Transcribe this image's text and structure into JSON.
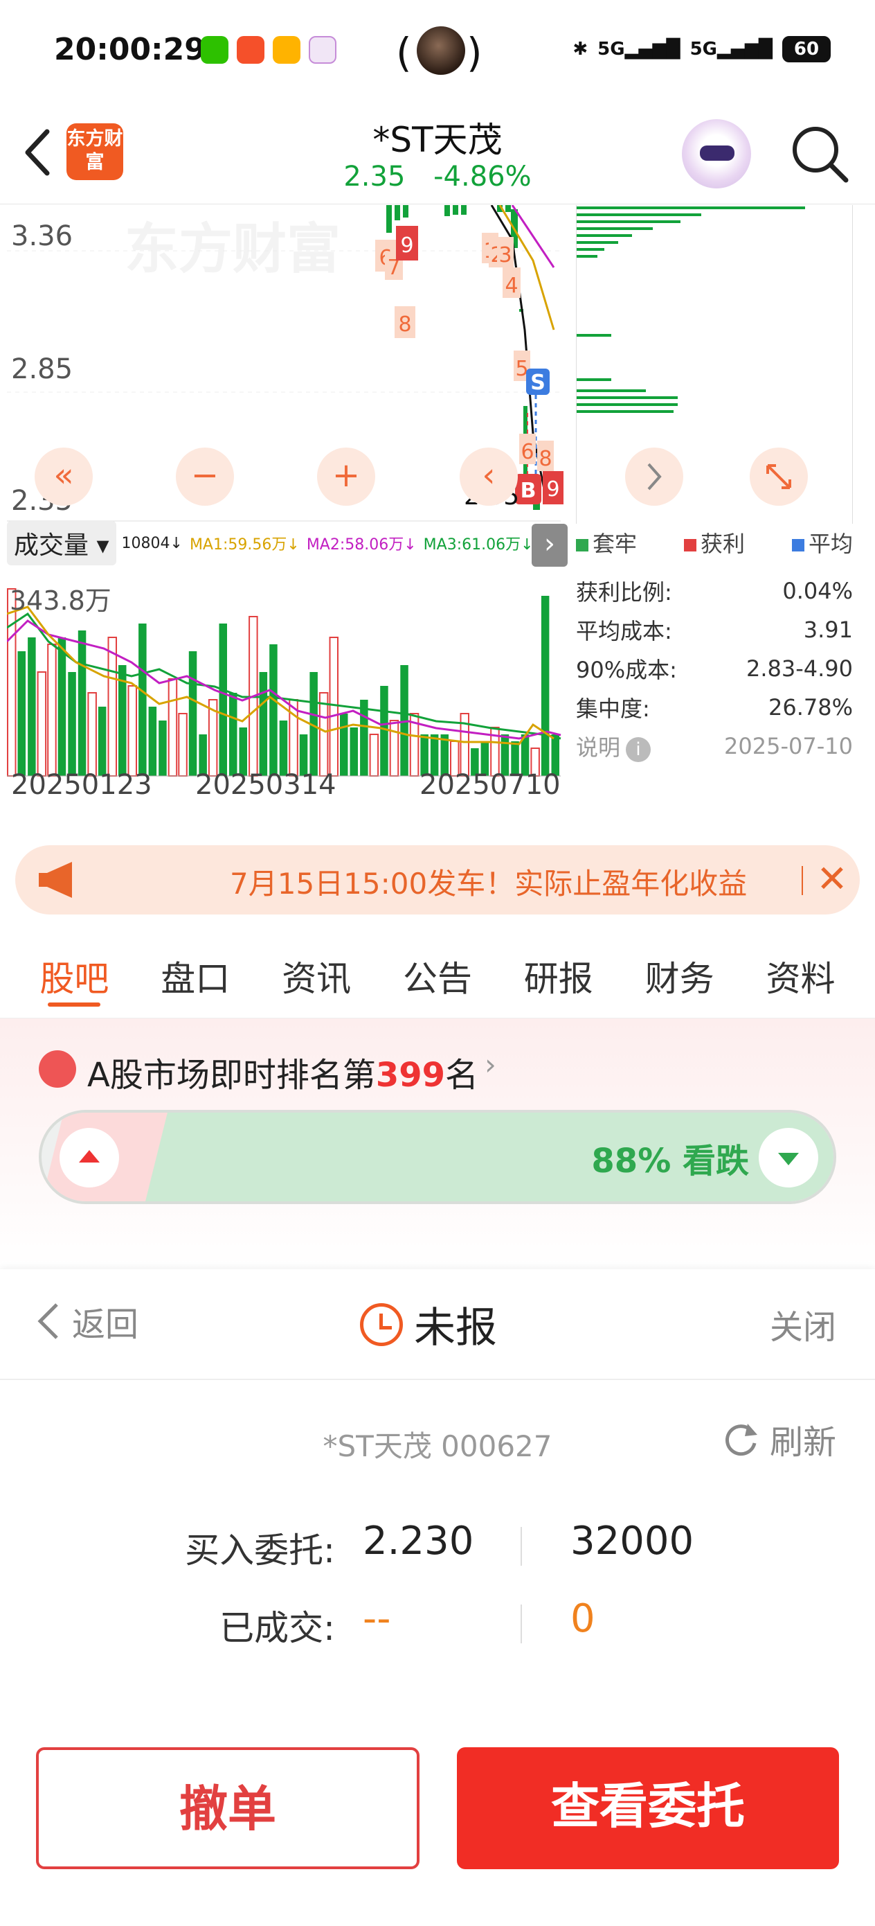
{
  "status_bar": {
    "time": "20:00:29",
    "battery": "60",
    "signal_labels": [
      "5G",
      "5G"
    ]
  },
  "header": {
    "logo_text": "东方财富",
    "stock_name": "*ST天茂",
    "price": "2.35",
    "change_pct": "-4.86%"
  },
  "kline": {
    "y_labels": [
      "3.36",
      "2.85",
      "2.35"
    ],
    "current_price_label": "2.35",
    "watermark": "东方财富",
    "markers": {
      "trade_signals": [
        "S",
        "B",
        "9"
      ],
      "counts": [
        "6",
        "7",
        "9",
        "8",
        "1",
        "2",
        "3",
        "4",
        "5",
        "6",
        "8",
        "9"
      ]
    },
    "controls": [
      "«",
      "−",
      "+",
      "‹",
      "›",
      "⤢"
    ]
  },
  "volume": {
    "selector_label": "成交量",
    "value": "10804↓",
    "ma1": "MA1:59.56万↓",
    "ma2": "MA2:58.06万↓",
    "ma3": "MA3:61.06万↓",
    "max_label": "343.8万",
    "dates": [
      "20250123",
      "20250314",
      "20250710"
    ]
  },
  "chip": {
    "legend": [
      {
        "label": "套牢",
        "color": "#2fa84f"
      },
      {
        "label": "获利",
        "color": "#e24040"
      },
      {
        "label": "平均",
        "color": "#3c7ce0"
      }
    ],
    "stats": [
      {
        "label": "获利比例:",
        "value": "0.04%"
      },
      {
        "label": "平均成本:",
        "value": "3.91"
      },
      {
        "label": "90%成本:",
        "value": "2.83-4.90"
      },
      {
        "label": "集中度:",
        "value": "26.78%"
      }
    ],
    "note_label": "说明",
    "note_date": "2025-07-10"
  },
  "promo": {
    "text": "7月15日15:00发车！实际止盈年化收益"
  },
  "tabs": [
    "股吧",
    "盘口",
    "资讯",
    "公告",
    "研报",
    "财务",
    "资料"
  ],
  "ranking": {
    "prefix": "A股市场即时排名第",
    "number": "399",
    "suffix": "名",
    "vote_label": "88% 看跌",
    "bearish_pct": 88
  },
  "order_sheet": {
    "back_label": "返回",
    "title": "未报",
    "close_label": "关闭",
    "stock_line": "*ST天茂 000627",
    "refresh_label": "刷新",
    "buy_label": "买入委托:",
    "buy_price": "2.230",
    "buy_qty": "32000",
    "filled_label": "已成交:",
    "filled_price": "--",
    "filled_qty": "0",
    "cancel_button": "撤单",
    "view_button": "查看委托"
  },
  "colors": {
    "accent": "#f05a22",
    "down_green": "#12a23a",
    "up_red": "#e24040",
    "primary_button": "#f12d25"
  }
}
